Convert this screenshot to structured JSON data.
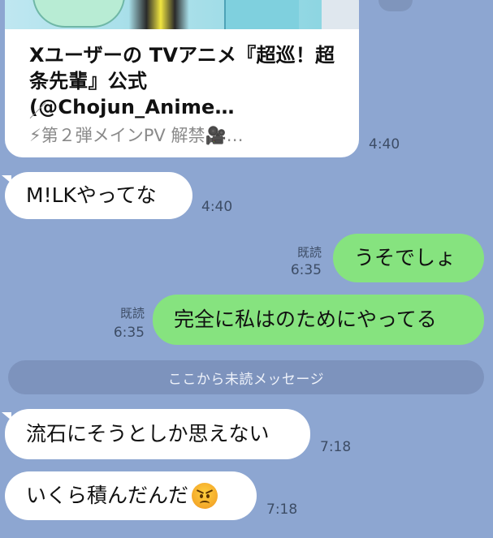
{
  "link_preview": {
    "title": "Xユーザーの TVアニメ『超巡！超条先輩』公式 (@Chojun_Anime…",
    "description": "／\n⚡第２弾メインPV 解禁🎥…",
    "time": "4:40"
  },
  "messages": [
    {
      "direction": "in",
      "text": "M!LKやってな",
      "time": "4:40"
    },
    {
      "direction": "out",
      "text": "うそでしょ",
      "read": "既読",
      "time": "6:35"
    },
    {
      "direction": "out",
      "text": "完全に私はのためにやってる",
      "read": "既読",
      "time": "6:35"
    },
    {
      "direction": "in",
      "text": "流石にそうとしか思えない",
      "time": "7:18"
    },
    {
      "direction": "in",
      "text": "いくら積んだんだ",
      "emoji": "angry-face-emoji",
      "time": "7:18"
    }
  ],
  "unread_divider": "ここから未読メッセージ",
  "colors": {
    "background": "#8da6d1",
    "bubble_in": "#ffffff",
    "bubble_out": "#86e37f",
    "divider": "#7d93bd"
  }
}
